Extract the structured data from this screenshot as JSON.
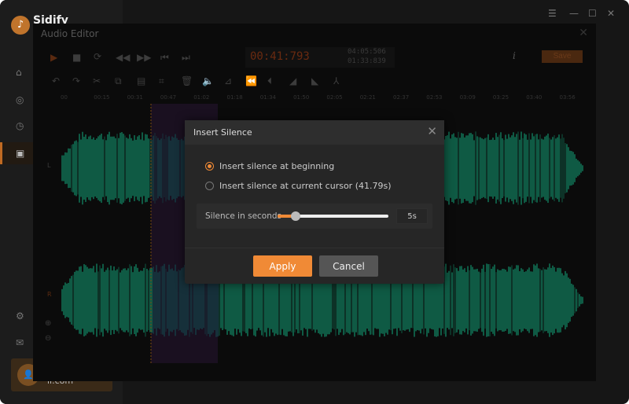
{
  "app": {
    "brand": "Sidify",
    "user_email": "il.com",
    "window_controls": [
      "menu-icon",
      "minimize-icon",
      "maximize-icon",
      "close-icon"
    ],
    "accent": "#f08a36"
  },
  "sidebar": {
    "items": [
      {
        "icon": "home-icon"
      },
      {
        "icon": "convert-icon"
      },
      {
        "icon": "clock-icon"
      },
      {
        "icon": "toolbox-icon",
        "active": true
      },
      {
        "icon": "settings-icon"
      },
      {
        "icon": "mail-icon"
      }
    ]
  },
  "editor": {
    "title": "Audio Editor",
    "current_time": "00:41:793",
    "total_time": "04:05:506",
    "selection_time": "01:33:839",
    "save_label": "Save",
    "ruler_ticks": [
      "00",
      "00:15",
      "00:31",
      "00:47",
      "01:02",
      "01:18",
      "01:34",
      "01:50",
      "02:05",
      "02:21",
      "02:37",
      "02:53",
      "03:09",
      "03:25",
      "03:40",
      "03:56"
    ],
    "channels": [
      "L",
      "R"
    ],
    "waveform_color": "#0f5a44"
  },
  "dialog": {
    "title": "Insert Silence",
    "options": [
      {
        "label": "Insert silence at beginning",
        "selected": true
      },
      {
        "label": "Insert silence at current cursor (41.79s)",
        "selected": false
      }
    ],
    "slider_label": "Silence in seconds",
    "slider_fraction": 0.16,
    "slider_value": "5s",
    "apply_label": "Apply",
    "cancel_label": "Cancel"
  }
}
